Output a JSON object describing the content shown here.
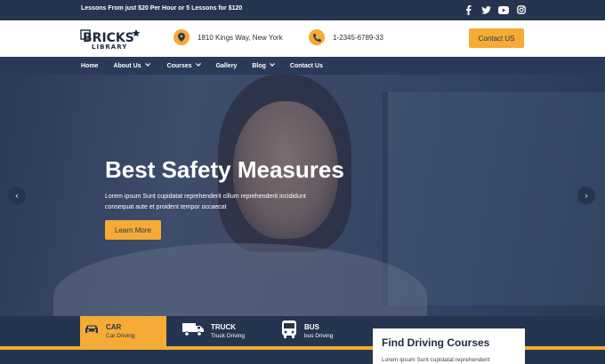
{
  "topbar": {
    "promo": "Lessons From just $20 Per Hour or 5 Lessons for $120",
    "social_icons": [
      "facebook-icon",
      "twitter-icon",
      "youtube-icon",
      "instagram-icon"
    ]
  },
  "header": {
    "logo_alt": "BRICKS LIBRARY",
    "address": "1810 Kings Way, New York",
    "phone": "1-2345-6789-33",
    "contact_button": "Contact US"
  },
  "nav": {
    "items": [
      {
        "label": "Home",
        "dropdown": false
      },
      {
        "label": "About Us",
        "dropdown": true
      },
      {
        "label": "Courses",
        "dropdown": true
      },
      {
        "label": "Gallery",
        "dropdown": false
      },
      {
        "label": "Blog",
        "dropdown": true
      },
      {
        "label": "Contact Us",
        "dropdown": false
      }
    ]
  },
  "hero": {
    "title": "Best Safety Measures",
    "description": "Lorem ipsum Sunt cupidatat reprehenderit cillum reprehenderit incididunt consequat aute et proident tempor occaecat",
    "cta": "Learn More",
    "prev_arrow": "‹",
    "next_arrow": "›"
  },
  "courses": {
    "tabs": [
      {
        "title": "CAR",
        "subtitle": "Car Driving",
        "icon": "car-icon",
        "active": true
      },
      {
        "title": "TRUCK",
        "subtitle": "Truck Driving",
        "icon": "truck-icon",
        "active": false
      },
      {
        "title": "BUS",
        "subtitle": "bus Driving",
        "icon": "bus-icon",
        "active": false
      }
    ]
  },
  "find_panel": {
    "title": "Find Driving Courses",
    "text": "Lorem ipsum Sunt cupidatat reprehenderit"
  },
  "colors": {
    "navy": "#25354f",
    "nav_blue": "#2a3b5a",
    "accent": "#f5ab35",
    "white": "#ffffff"
  }
}
